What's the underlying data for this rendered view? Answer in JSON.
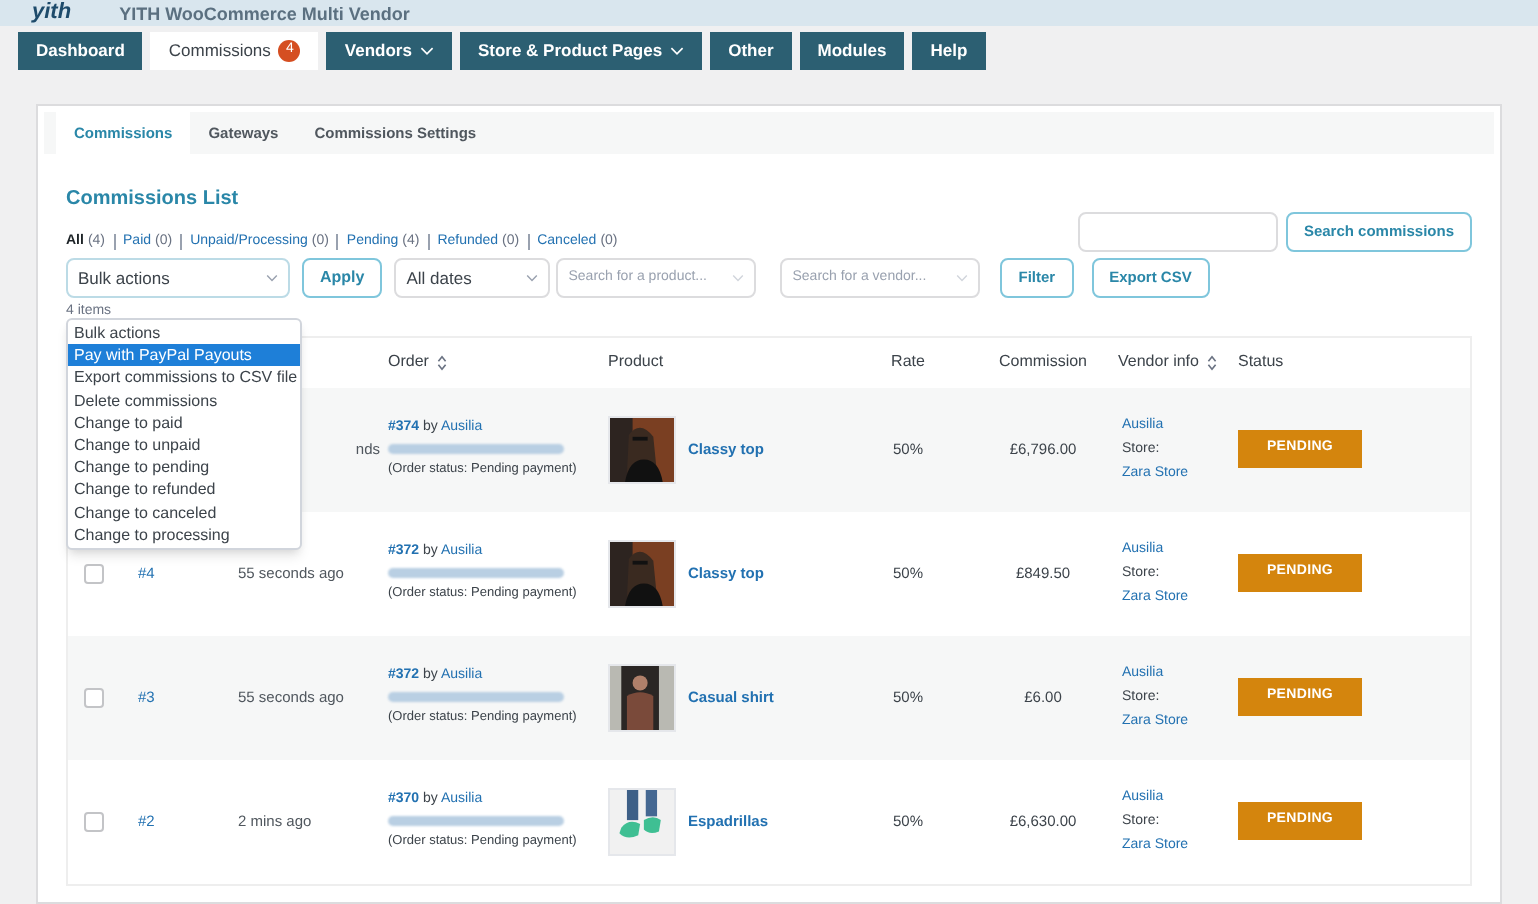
{
  "header": {
    "logo": "yith",
    "title": "YITH WooCommerce Multi Vendor"
  },
  "nav": [
    {
      "label": "Dashboard",
      "selected": false,
      "dropdown": false
    },
    {
      "label": "Commissions",
      "selected": true,
      "dropdown": false,
      "badge": "4"
    },
    {
      "label": "Vendors",
      "selected": false,
      "dropdown": true
    },
    {
      "label": "Store & Product Pages",
      "selected": false,
      "dropdown": true
    },
    {
      "label": "Other",
      "selected": false,
      "dropdown": false
    },
    {
      "label": "Modules",
      "selected": false,
      "dropdown": false
    },
    {
      "label": "Help",
      "selected": false,
      "dropdown": false
    }
  ],
  "subtabs": [
    {
      "label": "Commissions",
      "selected": true
    },
    {
      "label": "Gateways",
      "selected": false
    },
    {
      "label": "Commissions Settings",
      "selected": false
    }
  ],
  "heading": "Commissions List",
  "status_filters": [
    {
      "label": "All",
      "count": "(4)",
      "selected": true
    },
    {
      "label": "Paid",
      "count": "(0)",
      "selected": false
    },
    {
      "label": "Unpaid/Processing",
      "count": "(0)",
      "selected": false
    },
    {
      "label": "Pending",
      "count": "(4)",
      "selected": false
    },
    {
      "label": "Refunded",
      "count": "(0)",
      "selected": false
    },
    {
      "label": "Canceled",
      "count": "(0)",
      "selected": false
    }
  ],
  "toolbar": {
    "bulk_actions": "Bulk actions",
    "apply": "Apply",
    "dates": "All dates",
    "product_placeholder": "Search for a product...",
    "vendor_placeholder": "Search for a vendor...",
    "filter": "Filter",
    "export": "Export CSV",
    "search_button": "Search commissions",
    "items": "4 items"
  },
  "bulk_menu": [
    {
      "label": "Bulk actions",
      "selected": false
    },
    {
      "label": "Pay with PayPal Payouts",
      "selected": true
    },
    {
      "label": "Export commissions to CSV file",
      "selected": false
    },
    {
      "label": "Delete commissions",
      "selected": false
    },
    {
      "label": "Change to paid",
      "selected": false
    },
    {
      "label": "Change to unpaid",
      "selected": false
    },
    {
      "label": "Change to pending",
      "selected": false
    },
    {
      "label": "Change to refunded",
      "selected": false
    },
    {
      "label": "Change to canceled",
      "selected": false
    },
    {
      "label": "Change to processing",
      "selected": false
    }
  ],
  "table": {
    "columns": [
      {
        "label": "Order",
        "sortable": true
      },
      {
        "label": "Product",
        "sortable": false
      },
      {
        "label": "Rate",
        "sortable": false
      },
      {
        "label": "Commission",
        "sortable": false
      },
      {
        "label": "Vendor info",
        "sortable": true
      },
      {
        "label": "Status",
        "sortable": false
      }
    ],
    "rows": [
      {
        "time": "nds",
        "order": "#374",
        "by": "by",
        "customer": "Ausilia",
        "order_status": "(Order status: Pending payment)",
        "product": "Classy top",
        "rate": "50%",
        "commission": "£6,796.00",
        "vendor": "Ausilia",
        "store_label": "Store:",
        "store": "Zara Store",
        "status": "PENDING"
      },
      {
        "checked": false,
        "id": "#4",
        "time": "55 seconds ago",
        "order": "#372",
        "by": "by",
        "customer": "Ausilia",
        "order_status": "(Order status: Pending payment)",
        "product": "Classy top",
        "rate": "50%",
        "commission": "£849.50",
        "vendor": "Ausilia",
        "store_label": "Store:",
        "store": "Zara Store",
        "status": "PENDING"
      },
      {
        "checked": false,
        "id": "#3",
        "time": "55 seconds ago",
        "order": "#372",
        "by": "by",
        "customer": "Ausilia",
        "order_status": "(Order status: Pending payment)",
        "product": "Casual shirt",
        "rate": "50%",
        "commission": "£6.00",
        "vendor": "Ausilia",
        "store_label": "Store:",
        "store": "Zara Store",
        "status": "PENDING"
      },
      {
        "checked": false,
        "id": "#2",
        "time": "2 mins ago",
        "order": "#370",
        "by": "by",
        "customer": "Ausilia",
        "order_status": "(Order status: Pending payment)",
        "product": "Espadrillas",
        "rate": "50%",
        "commission": "£6,630.00",
        "vendor": "Ausilia",
        "store_label": "Store:",
        "store": "Zara Store",
        "status": "PENDING"
      }
    ]
  }
}
